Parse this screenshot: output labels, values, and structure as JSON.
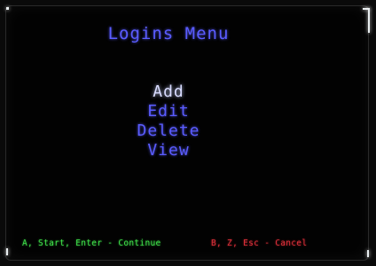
{
  "screen": {
    "title": "Logins Menu"
  },
  "menu": {
    "items": [
      {
        "label": "Add",
        "selected": true
      },
      {
        "label": "Edit",
        "selected": false
      },
      {
        "label": "Delete",
        "selected": false
      },
      {
        "label": "View",
        "selected": false
      }
    ]
  },
  "footer": {
    "continue_hint": "A, Start, Enter - Continue",
    "cancel_hint": "B, Z, Esc - Cancel"
  },
  "colors": {
    "text_primary": "#5a5cff",
    "selected": "#d9dcff",
    "continue": "#3fe04a",
    "cancel": "#e0303a",
    "background": "#020202"
  }
}
